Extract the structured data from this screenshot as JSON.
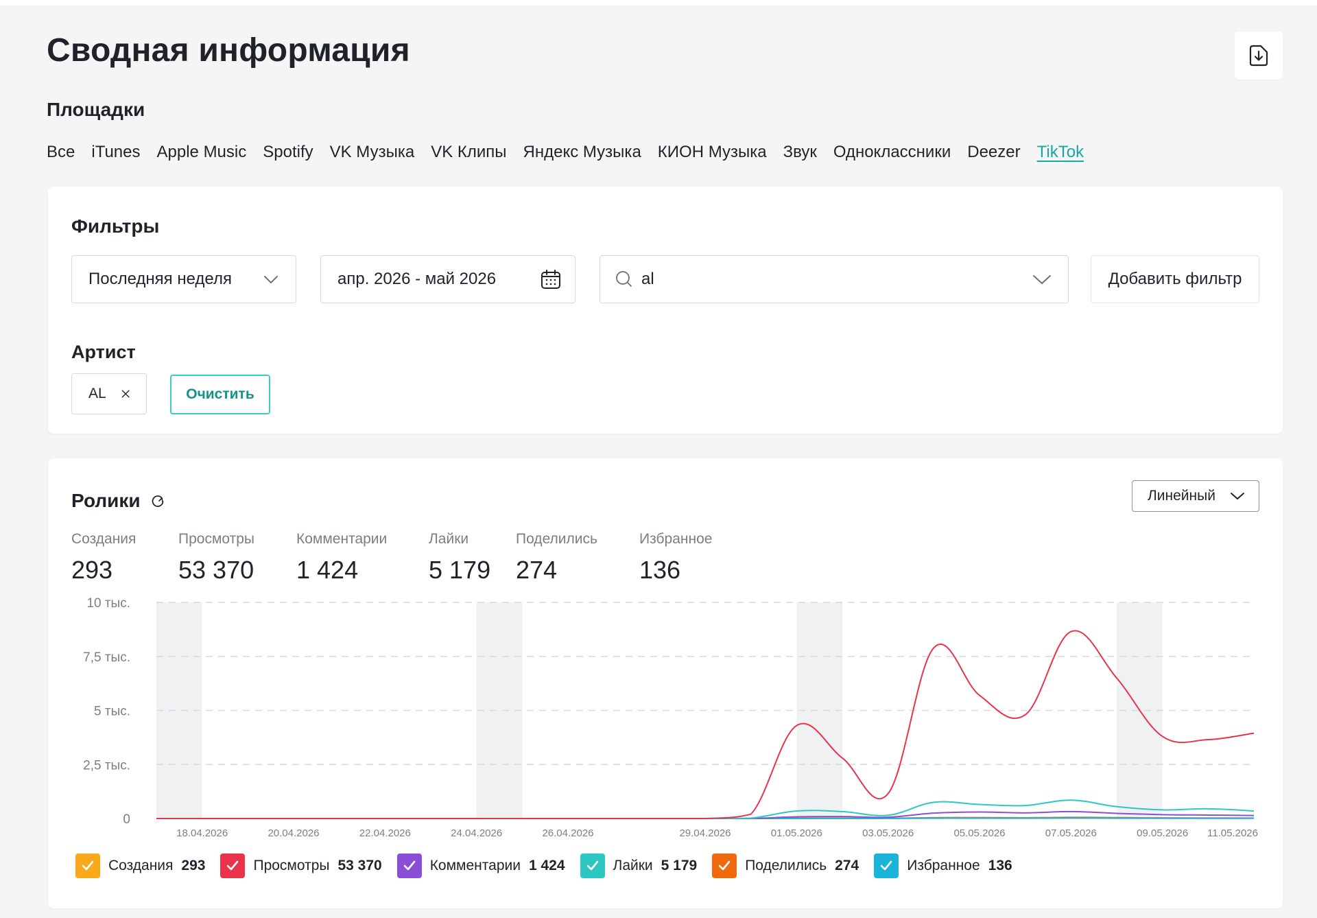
{
  "header": {
    "title": "Сводная информация",
    "export_icon": "file-download-icon"
  },
  "platforms": {
    "label": "Площадки",
    "tabs": [
      "Все",
      "iTunes",
      "Apple Music",
      "Spotify",
      "VK Музыка",
      "VK Клипы",
      "Яндекс Музыка",
      "КИОН Музыка",
      "Звук",
      "Одноклассники",
      "Deezer",
      "TikTok"
    ],
    "active": "TikTok"
  },
  "filters": {
    "title": "Фильтры",
    "period_value": "Последняя неделя",
    "date_range_value": "апр. 2026 - май 2026",
    "search_value": "al",
    "add_filter_label": "Добавить фильтр",
    "artist_label": "Артист",
    "artist_chip": "AL",
    "clear_label": "Очистить"
  },
  "videos": {
    "title": "Ролики",
    "chart_type_label": "Линейный",
    "metrics": [
      {
        "label": "Создания",
        "value": "293"
      },
      {
        "label": "Просмотры",
        "value": "53 370"
      },
      {
        "label": "Комментарии",
        "value": "1 424"
      },
      {
        "label": "Лайки",
        "value": "5 179"
      },
      {
        "label": "Поделились",
        "value": "274"
      },
      {
        "label": "Избранное",
        "value": "136"
      }
    ]
  },
  "legend": [
    {
      "name": "Создания",
      "value": "293",
      "color": "#f7a81b",
      "checked": true
    },
    {
      "name": "Просмотры",
      "value": "53 370",
      "color": "#e8334a",
      "checked": true
    },
    {
      "name": "Комментарии",
      "value": "1 424",
      "color": "#8a4fd6",
      "checked": true
    },
    {
      "name": "Лайки",
      "value": "5 179",
      "color": "#2cc7c3",
      "checked": true
    },
    {
      "name": "Поделились",
      "value": "274",
      "color": "#ef6a0f",
      "checked": true
    },
    {
      "name": "Избранное",
      "value": "136",
      "color": "#1ab4d9",
      "checked": true
    }
  ],
  "chart_data": {
    "type": "line",
    "y_ticks": [
      "0",
      "2,5 тыс.",
      "5 тыс.",
      "7,5 тыс.",
      "10 тыс."
    ],
    "ylim": [
      0,
      10000
    ],
    "grid": true,
    "legend_position": "bottom-left",
    "weekend_bands": [
      [
        "2026-04-17",
        "2026-04-18"
      ],
      [
        "2026-04-24",
        "2026-04-25"
      ],
      [
        "2026-05-01",
        "2026-05-02"
      ],
      [
        "2026-05-08",
        "2026-05-09"
      ]
    ],
    "x_tick_labels": [
      "18.04.2026",
      "20.04.2026",
      "22.04.2026",
      "24.04.2026",
      "26.04.2026",
      "29.04.2026",
      "01.05.2026",
      "03.05.2026",
      "05.05.2026",
      "07.05.2026",
      "09.05.2026",
      "11.05.2026"
    ],
    "x": [
      "2026-04-17",
      "2026-04-18",
      "2026-04-19",
      "2026-04-20",
      "2026-04-21",
      "2026-04-22",
      "2026-04-23",
      "2026-04-24",
      "2026-04-25",
      "2026-04-26",
      "2026-04-27",
      "2026-04-28",
      "2026-04-29",
      "2026-04-30",
      "2026-05-01",
      "2026-05-02",
      "2026-05-03",
      "2026-05-04",
      "2026-05-05",
      "2026-05-06",
      "2026-05-07",
      "2026-05-08",
      "2026-05-09",
      "2026-05-10",
      "2026-05-11"
    ],
    "series": [
      {
        "name": "Создания",
        "color": "#f7a81b",
        "values": [
          0,
          0,
          0,
          0,
          0,
          0,
          0,
          0,
          0,
          0,
          0,
          0,
          0,
          0,
          20,
          25,
          15,
          30,
          35,
          30,
          40,
          35,
          30,
          25,
          20
        ]
      },
      {
        "name": "Просмотры",
        "color": "#e8334a",
        "values": [
          0,
          0,
          0,
          0,
          0,
          0,
          0,
          0,
          0,
          0,
          0,
          0,
          0,
          200,
          4300,
          2800,
          1150,
          7900,
          5700,
          4800,
          8650,
          6500,
          3800,
          3650,
          3950
        ]
      },
      {
        "name": "Комментарии",
        "color": "#8a4fd6",
        "values": [
          0,
          0,
          0,
          0,
          0,
          0,
          0,
          0,
          0,
          0,
          0,
          0,
          0,
          0,
          80,
          90,
          60,
          250,
          300,
          260,
          320,
          240,
          180,
          160,
          140
        ]
      },
      {
        "name": "Лайки",
        "color": "#2cc7c3",
        "values": [
          0,
          0,
          0,
          0,
          0,
          0,
          0,
          0,
          0,
          0,
          0,
          0,
          0,
          20,
          350,
          320,
          150,
          750,
          650,
          600,
          850,
          550,
          400,
          450,
          350
        ]
      },
      {
        "name": "Поделились",
        "color": "#ef6a0f",
        "values": [
          0,
          0,
          0,
          0,
          0,
          0,
          0,
          0,
          0,
          0,
          0,
          0,
          0,
          0,
          10,
          12,
          8,
          40,
          45,
          35,
          55,
          40,
          25,
          20,
          18
        ]
      },
      {
        "name": "Избранное",
        "color": "#1ab4d9",
        "values": [
          0,
          0,
          0,
          0,
          0,
          0,
          0,
          0,
          0,
          0,
          0,
          0,
          0,
          0,
          5,
          6,
          4,
          20,
          25,
          18,
          30,
          20,
          15,
          12,
          10
        ]
      }
    ]
  }
}
